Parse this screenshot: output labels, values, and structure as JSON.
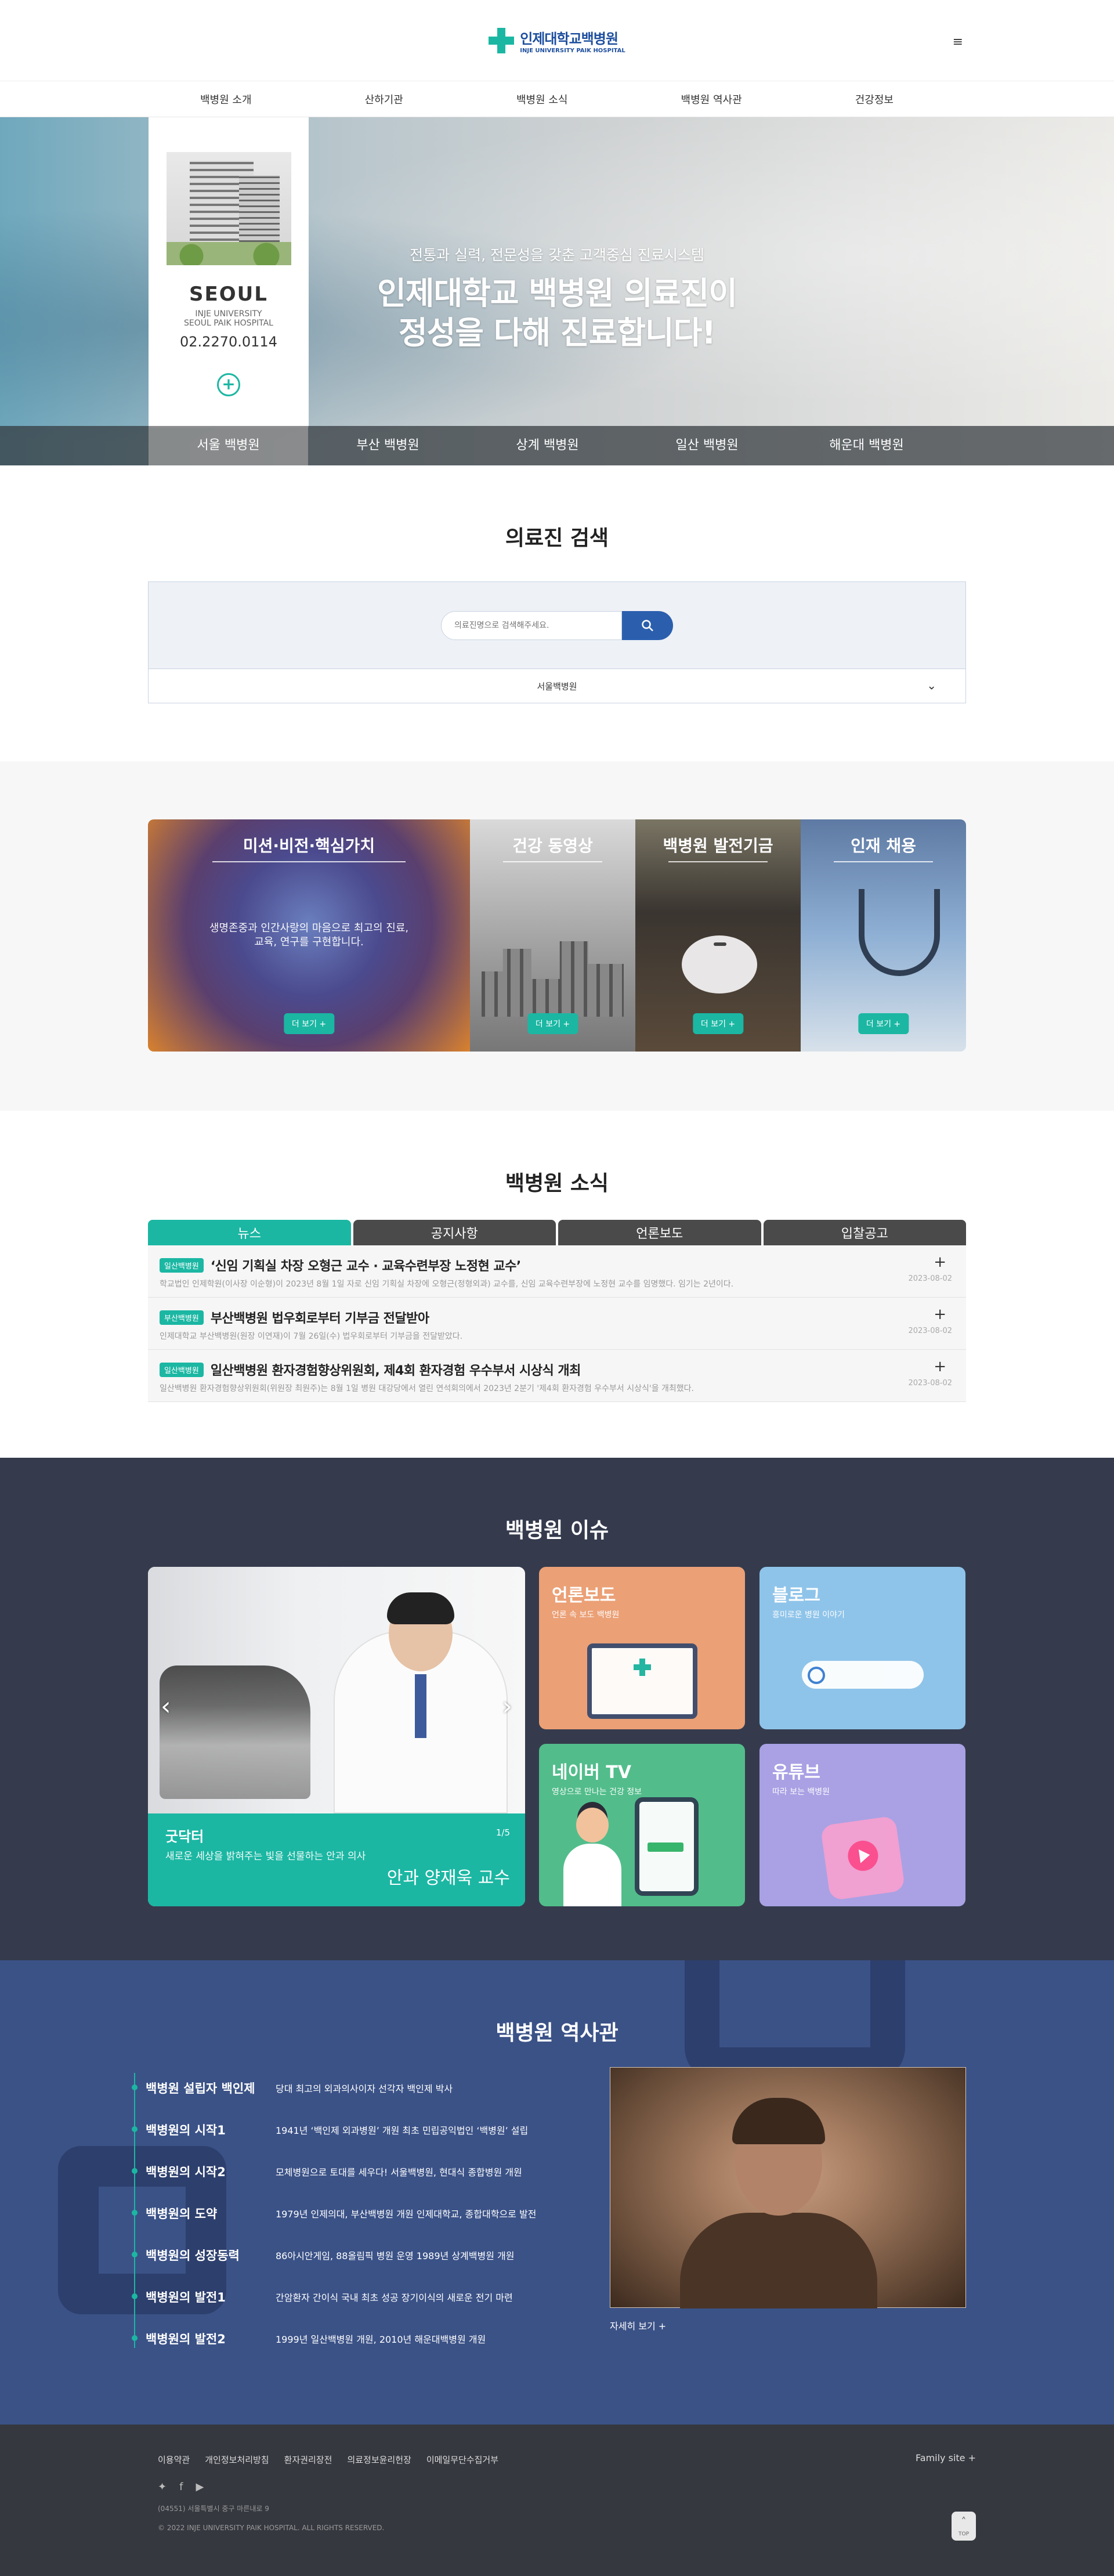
{
  "header": {
    "logo_ko": "인제대학교백병원",
    "logo_en": "INJE UNIVERSITY PAIK HOSPITAL"
  },
  "gnb": [
    "백병원 소개",
    "산하기관",
    "백병원 소식",
    "백병원 역사관",
    "건강정보"
  ],
  "hero": {
    "city": "SEOUL",
    "en_line1": "INJE UNIVERSITY",
    "en_line2": "SEOUL PAIK HOSPITAL",
    "tel": "02.2270.0114",
    "subtitle": "전통과 실력, 전문성을 갖춘 고객중심 진료시스템",
    "title_line1": "인제대학교 백병원 의료진이",
    "title_line2": "정성을 다해 진료합니다!",
    "tabs": [
      "서울 백병원",
      "부산 백병원",
      "상계 백병원",
      "일산 백병원",
      "해운대 백병원"
    ]
  },
  "doctor_search": {
    "title": "의료진 검색",
    "placeholder": "의료진명으로 검색해주세요.",
    "selected_hospital": "서울백병원"
  },
  "cards": [
    {
      "title": "미션·비전·핵심가치",
      "desc_line1": "생명존중과 인간사랑의 마음으로 최고의 진료,",
      "desc_line2": "교육, 연구를 구현합니다.",
      "more": "더 보기 +"
    },
    {
      "title": "건강 동영상",
      "more": "더 보기 +"
    },
    {
      "title": "백병원 발전기금",
      "more": "더 보기 +"
    },
    {
      "title": "인재 채용",
      "more": "더 보기 +"
    }
  ],
  "news": {
    "title": "백병원 소식",
    "tabs": [
      "뉴스",
      "공지사항",
      "언론보도",
      "입찰공고"
    ],
    "items": [
      {
        "badge": "일산백병원",
        "title": "‘신임 기획실 차장 오형근 교수 · 교육수련부장 노정현 교수’",
        "desc": "학교법인 인제학원(이사장 이순형)이 2023년 8월 1일 자로 신임 기획실 차장에 오형근(정형외과) 교수를, 신임 교육수련부장에 노정현 교수를 임명했다. 임기는 2년이다.",
        "date": "2023-08-02"
      },
      {
        "badge": "부산백병원",
        "title": "부산백병원 법우회로부터 기부금 전달받아",
        "desc": "인제대학교 부산백병원(원장 이연재)이 7월 26일(수) 법우회로부터 기부금을 전달받았다.",
        "date": "2023-08-02"
      },
      {
        "badge": "일산백병원",
        "title": "일산백병원 환자경험향상위원회, 제4회 환자경험 우수부서 시상식 개최",
        "desc": "일산백병원 환자경험향상위원회(위원장 최원주)는 8월 1일 병원 대강당에서 열린 연석회의에서 2023년 2분기 '제4회 환자경험 우수부서 시상식'을 개최했다.",
        "date": "2023-08-02"
      }
    ]
  },
  "issues": {
    "title": "백병원 이슈",
    "feature": {
      "title": "굿닥터",
      "sub": "새로운 세상을 밝혀주는 빛을 선물하는 안과 의사",
      "page": "1/5",
      "name": "안과 양재욱 교수"
    },
    "tiles": [
      {
        "title": "언론보도",
        "sub": "언론 속 보도 백병원"
      },
      {
        "title": "블로그",
        "sub": "흥미로운 병원 이야기"
      },
      {
        "title": "네이버 TV",
        "sub": "영상으로 만나는 건강 정보"
      },
      {
        "title": "유튜브",
        "sub": "따라 보는 백병원"
      }
    ]
  },
  "history": {
    "title": "백병원 역사관",
    "items": [
      {
        "title": "백병원 설립자 백인제",
        "desc": "당대 최고의 외과의사이자 선각자 백인제 박사"
      },
      {
        "title": "백병원의 시작1",
        "desc": "1941년 ‘백인제 외과병원’ 개원 최초 민립공익법인 ‘백병원’ 설립"
      },
      {
        "title": "백병원의 시작2",
        "desc": "모체병원으로 토대를 세우다! 서울백병원, 현대식 종합병원 개원"
      },
      {
        "title": "백병원의 도약",
        "desc": "1979년 인제의대, 부산백병원 개원 인제대학교, 종합대학으로 발전"
      },
      {
        "title": "백병원의 성장동력",
        "desc": "86아시안게임, 88올림픽 병원 운영 1989년 상계백병원 개원"
      },
      {
        "title": "백병원의 발전1",
        "desc": "간암환자 간이식 국내 최초 성공 장기이식의 새로운 전기 마련"
      },
      {
        "title": "백병원의 발전2",
        "desc": "1999년 일산백병원 개원, 2010년 해운대백병원 개원"
      }
    ],
    "more": "자세히 보기 +"
  },
  "footer": {
    "links": [
      "이용약관",
      "개인정보처리방침",
      "환자권리장전",
      "의료정보윤리헌장",
      "이메일무단수집거부"
    ],
    "family": "Family site +",
    "address": "(04551) 서울특별시 중구 마른내로 9",
    "copyright": "© 2022 INJE UNIVERSITY PAIK HOSPITAL. ALL RIGHTS RESERVED.",
    "top": "TOP"
  }
}
